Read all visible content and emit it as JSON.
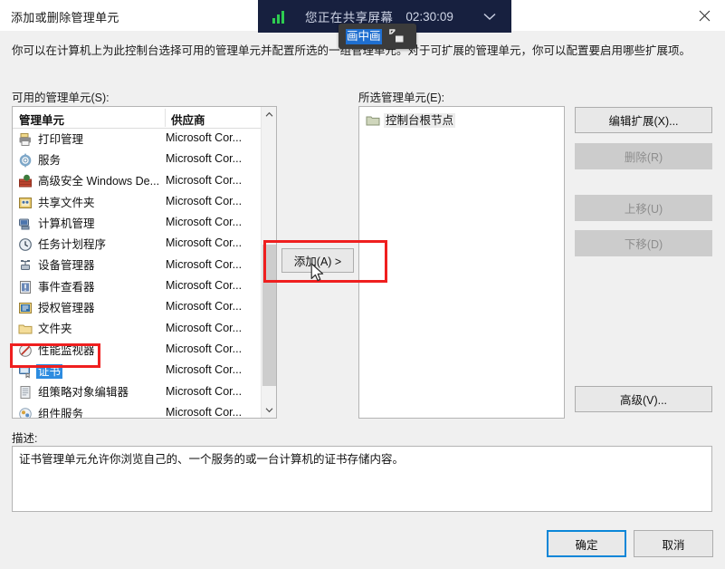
{
  "window": {
    "title": "添加或删除管理单元",
    "close_icon": "close-icon"
  },
  "share_bar": {
    "status_text": "您正在共享屏幕",
    "timer": "02:30:09",
    "signal_icon": "signal-bars-icon",
    "chevron_icon": "chevron-down-icon",
    "accent_color": "#17203f",
    "signal_color": "#2ecc50"
  },
  "pip_tooltip": {
    "label": "画中画",
    "icon": "picture-in-picture-icon",
    "highlight_color": "#1f6fd0"
  },
  "intro_text": "你可以在计算机上为此控制台选择可用的管理单元并配置所选的一组管理单元。对于可扩展的管理单元，你可以配置要启用哪些扩展项。",
  "available": {
    "label": "可用的管理单元(S):",
    "columns": [
      "管理单元",
      "供应商"
    ],
    "vendor_default": "Microsoft Cor...",
    "items": [
      {
        "name": "打印管理",
        "vendor": "Microsoft Cor...",
        "icon": "printer-icon",
        "selected": false
      },
      {
        "name": "服务",
        "vendor": "Microsoft Cor...",
        "icon": "gear-icon",
        "selected": false
      },
      {
        "name": "高级安全 Windows De...",
        "vendor": "Microsoft Cor...",
        "icon": "firewall-icon",
        "selected": false
      },
      {
        "name": "共享文件夹",
        "vendor": "Microsoft Cor...",
        "icon": "shared-folder-icon",
        "selected": false
      },
      {
        "name": "计算机管理",
        "vendor": "Microsoft Cor...",
        "icon": "computer-icon",
        "selected": false
      },
      {
        "name": "任务计划程序",
        "vendor": "Microsoft Cor...",
        "icon": "clock-icon",
        "selected": false
      },
      {
        "name": "设备管理器",
        "vendor": "Microsoft Cor...",
        "icon": "device-icon",
        "selected": false
      },
      {
        "name": "事件查看器",
        "vendor": "Microsoft Cor...",
        "icon": "event-log-icon",
        "selected": false
      },
      {
        "name": "授权管理器",
        "vendor": "Microsoft Cor...",
        "icon": "authorization-icon",
        "selected": false
      },
      {
        "name": "文件夹",
        "vendor": "Microsoft Cor...",
        "icon": "folder-icon",
        "selected": false
      },
      {
        "name": "性能监视器",
        "vendor": "Microsoft Cor...",
        "icon": "performance-icon",
        "selected": false
      },
      {
        "name": "证书",
        "vendor": "Microsoft Cor...",
        "icon": "certificate-icon",
        "selected": true
      },
      {
        "name": "组策略对象编辑器",
        "vendor": "Microsoft Cor...",
        "icon": "group-policy-icon",
        "selected": false
      },
      {
        "name": "组件服务",
        "vendor": "Microsoft Cor...",
        "icon": "component-icon",
        "selected": false
      }
    ]
  },
  "add_button": {
    "label": "添加(A)  >"
  },
  "selected": {
    "label": "所选管理单元(E):",
    "items": [
      {
        "name": "控制台根节点",
        "icon": "console-root-folder-icon"
      }
    ]
  },
  "right_buttons": [
    {
      "label": "编辑扩展(X)...",
      "enabled": true
    },
    {
      "label": "删除(R)",
      "enabled": false
    },
    {
      "label": "上移(U)",
      "enabled": false
    },
    {
      "label": "下移(D)",
      "enabled": false
    }
  ],
  "advanced_button": {
    "label": "高级(V)..."
  },
  "description": {
    "label": "描述:",
    "text": "证书管理单元允许你浏览自己的、一个服务的或一台计算机的证书存储内容。"
  },
  "footer": {
    "ok": "确定",
    "cancel": "取消",
    "focus_color": "#0a86d8"
  },
  "annotations": {
    "add_button_highlight": "red-rectangle",
    "certificate_highlight": "red-rectangle",
    "color": "#ef1f1f"
  }
}
